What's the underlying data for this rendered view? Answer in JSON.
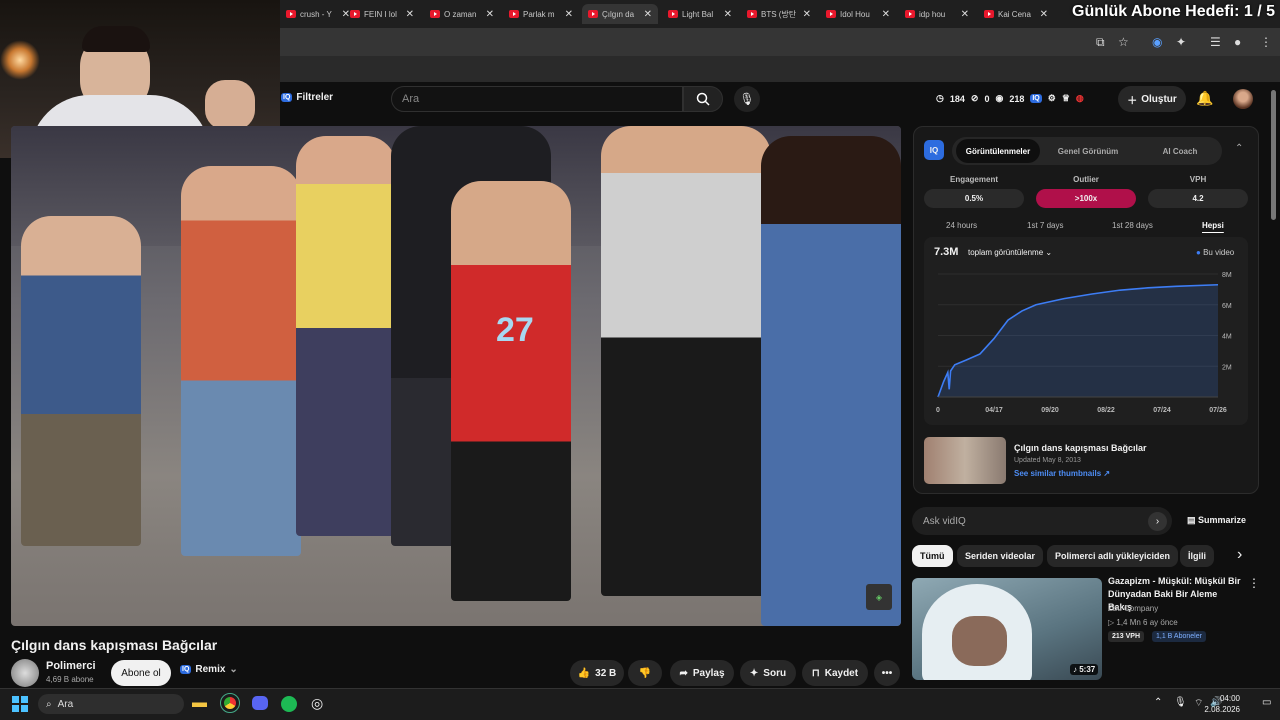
{
  "browser": {
    "tabs": [
      {
        "title": "crush - Y"
      },
      {
        "title": "FEIN I lol"
      },
      {
        "title": "O zaman"
      },
      {
        "title": "Parlak m"
      },
      {
        "title": "Çılgın da"
      },
      {
        "title": "Light Bal"
      },
      {
        "title": "BTS (방탄"
      },
      {
        "title": "Idol Hou"
      },
      {
        "title": "idp hou"
      },
      {
        "title": "Kai Cena"
      }
    ],
    "active_tab_index": 4,
    "overlay_text": "Günlük Abone Hedefi: 1 / 5"
  },
  "header": {
    "filter_label": "Filtreler",
    "search_placeholder": "Ara",
    "stats": {
      "views": "184",
      "comments": "0",
      "watch": "218"
    },
    "create_label": "Oluştur"
  },
  "video": {
    "title": "Çılgın dans kapışması Bağcılar",
    "channel_name": "Polimerci",
    "channel_subs": "4,69 B abone",
    "subscribe_label": "Abone ol",
    "remix_label": "Remix",
    "like_count": "32 B",
    "share_label": "Paylaş",
    "ask_label": "Soru",
    "save_label": "Kaydet",
    "jersey_number": "27"
  },
  "vidiq": {
    "tabs": [
      "Görüntülenmeler",
      "Genel Görünüm",
      "AI Coach"
    ],
    "active_tab": 0,
    "metrics": [
      {
        "label": "Engagement",
        "value": "0.5%"
      },
      {
        "label": "Outlier",
        "value": ">100x"
      },
      {
        "label": "VPH",
        "value": "4.2"
      }
    ],
    "ranges": [
      "24 hours",
      "1st 7 days",
      "1st 28 days",
      "Hepsi"
    ],
    "active_range": 3,
    "total": "7.3M",
    "total_label": "toplam görüntülenme",
    "legend": "Bu video",
    "video_card_title": "Çılgın dans kapışması Bağcılar",
    "video_card_date": "Updated May 8, 2013",
    "similar_link": "See similar thumbnails ↗",
    "ask_placeholder": "Ask vidIQ",
    "summarize_label": "Summarize"
  },
  "chart_data": {
    "type": "line",
    "x_ticks": [
      "0",
      "04/17",
      "09/20",
      "08/22",
      "07/24",
      "07/26"
    ],
    "y_ticks": [
      "0",
      "2M",
      "4M",
      "6M",
      "8M"
    ],
    "ylim": [
      0,
      8
    ],
    "series": [
      {
        "name": "Bu video",
        "x": [
          0,
          0.02,
          0.035,
          0.04,
          0.045,
          0.06,
          0.1,
          0.15,
          0.2,
          0.25,
          0.3,
          0.35,
          0.45,
          0.55,
          0.65,
          0.75,
          0.85,
          1.0
        ],
        "y": [
          0,
          1.0,
          1.6,
          0.5,
          1.7,
          2.1,
          2.4,
          2.8,
          3.8,
          5.0,
          5.6,
          6.0,
          6.4,
          6.7,
          6.95,
          7.1,
          7.2,
          7.3
        ]
      }
    ],
    "color": "#3d7df5"
  },
  "chips": [
    "Tümü",
    "Seriden videolar",
    "Polimerci adlı yükleyiciden",
    "İlgili"
  ],
  "recommendation": {
    "title": "Gazapizm - Müşkül: Müşkül Bir Dünyadan Baki Bir Aleme Bakış",
    "channel": "Zbu Company",
    "meta": "▷ 1,4 Mn   6 ay önce",
    "vph": "213 VPH",
    "subs": "1,1 B Aboneler",
    "duration": "5:37"
  },
  "taskbar": {
    "search_placeholder": "Ara",
    "time": "04:00",
    "date": "2.08.2026"
  }
}
